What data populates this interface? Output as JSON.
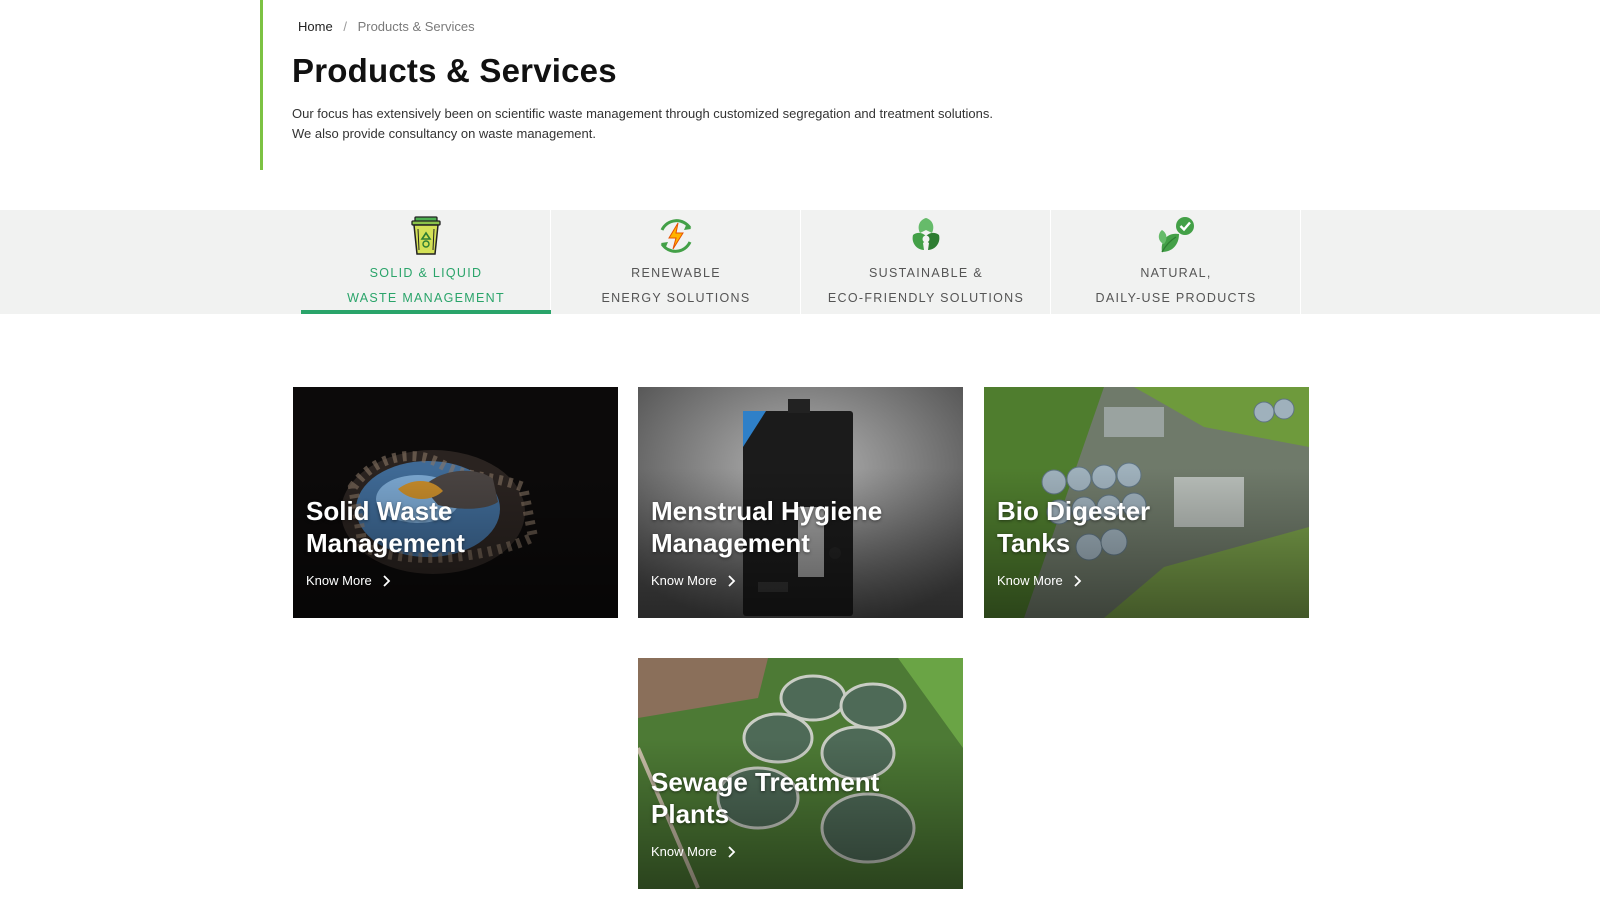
{
  "breadcrumb": {
    "home": "Home",
    "separator": "/",
    "current": "Products & Services"
  },
  "page": {
    "title": "Products & Services",
    "intro_line1": "Our focus has extensively been on scientific waste management through customized segregation and treatment solutions.",
    "intro_line2": "We also provide consultancy on waste management."
  },
  "tabs": [
    {
      "line1": "Solid & Liquid",
      "line2": "Waste Management",
      "icon": "recycle-bin-icon",
      "active": true
    },
    {
      "line1": "Renewable",
      "line2": "Energy Solutions",
      "icon": "renewable-energy-icon",
      "active": false
    },
    {
      "line1": "Sustainable &",
      "line2": "Eco-Friendly Solutions",
      "icon": "recycle-leaves-icon",
      "active": false
    },
    {
      "line1": "Natural,",
      "line2": "Daily-Use Products",
      "icon": "leaf-check-icon",
      "active": false
    }
  ],
  "cards": [
    {
      "title_line1": "Solid Waste",
      "title_line2": "Management",
      "link": "Know More"
    },
    {
      "title_line1": "Menstrual Hygiene",
      "title_line2": "Management",
      "link": "Know More"
    },
    {
      "title_line1": "Bio Digester",
      "title_line2": "Tanks",
      "link": "Know More"
    },
    {
      "title_line1": "Sewage Treatment",
      "title_line2": "Plants",
      "link": "Know More"
    }
  ],
  "colors": {
    "accent_green": "#2aa46a",
    "header_bar": "#7cc243",
    "tabbar_bg": "#f1f2f1"
  }
}
